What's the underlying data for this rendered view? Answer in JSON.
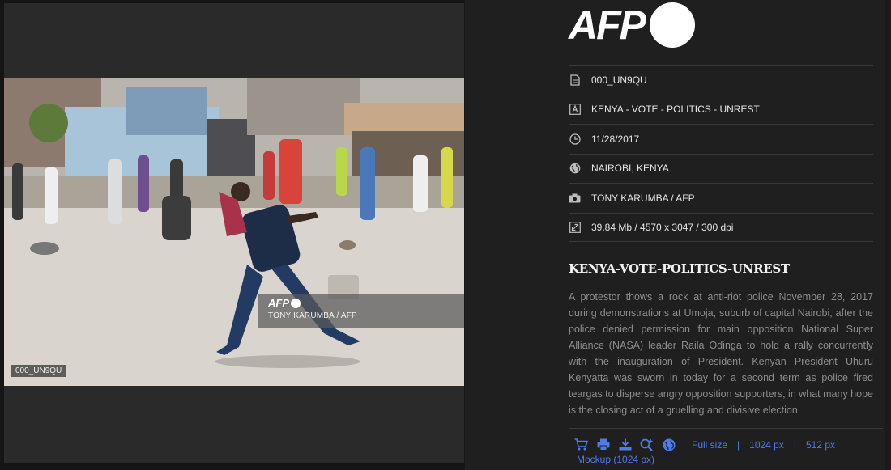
{
  "viewer": {
    "image_id_tag": "000_UN9QU",
    "watermark": {
      "logo": "AFP",
      "credit": "TONY KARUMBA / AFP"
    }
  },
  "panel": {
    "logo": "AFP",
    "meta": [
      {
        "icon": "document-icon",
        "value": "000_UN9QU"
      },
      {
        "icon": "text-icon",
        "value": "KENYA - VOTE - POLITICS - UNREST"
      },
      {
        "icon": "clock-icon",
        "value": "11/28/2017"
      },
      {
        "icon": "globe-icon",
        "value": "NAIROBI, KENYA"
      },
      {
        "icon": "camera-icon",
        "value": "TONY KARUMBA / AFP"
      },
      {
        "icon": "resize-icon",
        "value": "39.84 Mb / 4570 x 3047 / 300 dpi"
      }
    ],
    "headline": "KENYA-VOTE-POLITICS-UNREST",
    "caption": "A protestor thows a rock at anti-riot police November 28, 2017 during demonstrations at Umoja, suburb of capital Nairobi, after the police denied permission for main opposition National Super Alliance (NASA) leader Raila Odinga to hold a rally concurrently with the inauguration of President. Kenyan President Uhuru Kenyatta was sworn in today for a second term as police fired teargas to disperse angry opposition supporters, in what many hope is the closing act of a gruelling and divisive election",
    "actions": {
      "icons": [
        "cart-icon",
        "print-icon",
        "download-icon",
        "zoom-in-icon",
        "globe-icon"
      ],
      "full_size": "Full size",
      "sep": "|",
      "size_1024": "1024 px",
      "size_512": "512 px",
      "mockup": "Mockup (1024 px)"
    }
  },
  "colors": {
    "link": "#4f7be8",
    "panel_bg": "#1f1f1f",
    "viewer_bg": "#2a2a2a"
  }
}
